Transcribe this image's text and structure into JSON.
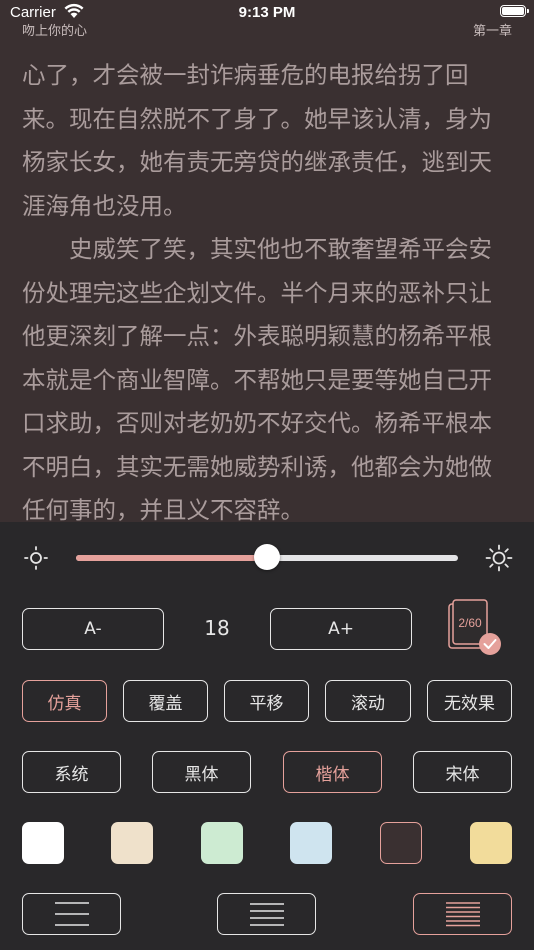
{
  "status_bar": {
    "carrier": "Carrier",
    "time": "9:13 PM"
  },
  "header": {
    "book_title": "吻上你的心",
    "chapter_title": "第一章"
  },
  "content": {
    "paragraphs": [
      "心了，才会被一封诈病垂危的电报给拐了回来。现在自然脱不了身了。她早该认清，身为杨家长女，她有责无旁贷的继承责任，逃到天涯海角也没用。",
      "史威笑了笑，其实他也不敢奢望希平会安份处理完这些企划文件。半个月来的恶补只让他更深刻了解一点：外表聪明颖慧的杨希平根本就是个商业智障。不帮她只是要等她自己开口求助，否则对老奶奶不好交代。杨希平根本不明白，其实无需她威势利诱，他都会为她做任何事的，并且义不容辞。"
    ]
  },
  "settings": {
    "brightness": 0.5,
    "font_size": {
      "decrease_label": "A-",
      "value": "18",
      "increase_label": "A+"
    },
    "progress_badge": "2/60",
    "page_turn": {
      "options": [
        "仿真",
        "覆盖",
        "平移",
        "滚动",
        "无效果"
      ],
      "selected": "仿真"
    },
    "font_family": {
      "options": [
        "系统",
        "黑体",
        "楷体",
        "宋体"
      ],
      "selected": "楷体"
    },
    "themes": [
      {
        "name": "white",
        "color": "#ffffff"
      },
      {
        "name": "beige",
        "color": "#efe1cb"
      },
      {
        "name": "green",
        "color": "#cdebd2"
      },
      {
        "name": "blue",
        "color": "#cfe4ef"
      },
      {
        "name": "dark",
        "color": "#3a3031",
        "selected": true
      },
      {
        "name": "parchment",
        "color": "#f2dc9b"
      }
    ],
    "line_spacing": {
      "options": [
        "loose",
        "medium",
        "tight"
      ],
      "selected": "tight"
    },
    "accent_color": "#e5a19b"
  }
}
